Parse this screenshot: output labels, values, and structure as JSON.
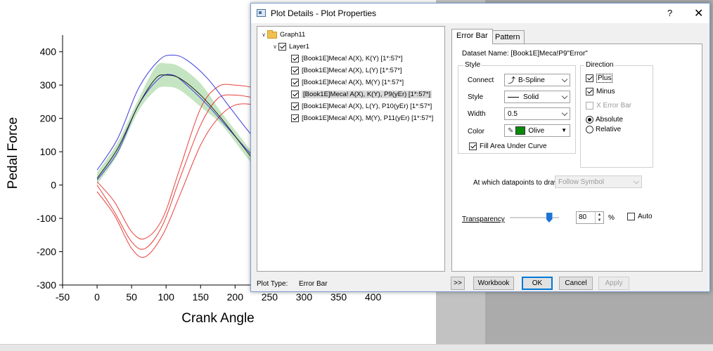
{
  "graph": {
    "y_axis_label": "Pedal Force",
    "x_axis_label": "Crank Angle",
    "y_ticks": [
      "400",
      "300",
      "200",
      "100",
      "0",
      "-100",
      "-200",
      "-300"
    ],
    "x_ticks": [
      "-50",
      "0",
      "50",
      "100",
      "150",
      "200",
      "250",
      "300",
      "350",
      "400"
    ],
    "colors": {
      "red": "#e8403c",
      "blue": "#3b3bdc",
      "black": "#1a1a1a",
      "band": "#9fd39a"
    }
  },
  "dialog": {
    "title": "Plot Details - Plot Properties",
    "help_glyph": "?",
    "close_glyph": "✕",
    "tree": {
      "root": "Graph11",
      "layer": "Layer1",
      "items": [
        "[Book1E]Meca! A(X), K(Y) [1*:57*]",
        "[Book1E]Meca! A(X), L(Y) [1*:57*]",
        "[Book1E]Meca! A(X), M(Y) [1*:57*]",
        "[Book1E]Meca! A(X), K(Y), P9(yEr) [1*:57*]",
        "[Book1E]Meca! A(X), L(Y), P10(yEr) [1*:57*]",
        "[Book1E]Meca! A(X), M(Y), P11(yEr) [1*:57*]"
      ]
    },
    "plot_type_label": "Plot Type:",
    "plot_type_value": "Error Bar",
    "tabs": [
      "Error Bar",
      "Pattern"
    ],
    "dataset_name": "Dataset Name: [Book1E]Meca!P9\"Error\"",
    "style_group": {
      "legend": "Style",
      "connect_label": "Connect",
      "connect_value": "B-Spline",
      "style_label": "Style",
      "style_value": "Solid",
      "width_label": "Width",
      "width_value": "0.5",
      "color_label": "Color",
      "color_value": "Olive",
      "color_hex": "#0a8a0a",
      "fill_label": "Fill Area Under Curve"
    },
    "direction_group": {
      "legend": "Direction",
      "plus": "Plus",
      "minus": "Minus",
      "x_error_bar": "X Error Bar",
      "absolute": "Absolute",
      "relative": "Relative"
    },
    "datapoints_label": "At which datapoints to draw",
    "datapoints_value": "Follow Symbol",
    "transparency_label": "Transparency",
    "transparency_value": "80",
    "transparency_unit": "%",
    "auto_label": "Auto",
    "buttons": {
      "expand": ">>",
      "workbook": "Workbook",
      "ok": "OK",
      "cancel": "Cancel",
      "apply": "Apply"
    }
  }
}
